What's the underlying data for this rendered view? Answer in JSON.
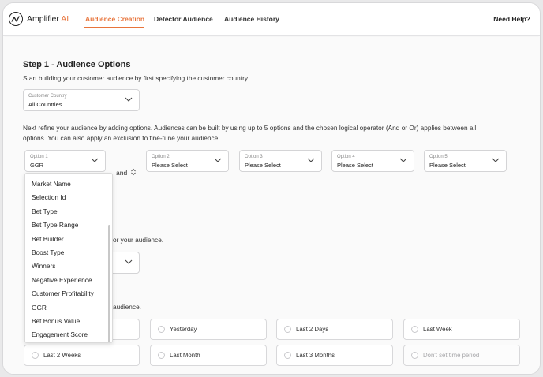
{
  "brand": {
    "name": "Amplifier",
    "suffix": "AI",
    "accent_color": "#e8743b"
  },
  "nav": {
    "tabs": [
      {
        "label": "Audience Creation",
        "active": true
      },
      {
        "label": "Defector Audience",
        "active": false
      },
      {
        "label": "Audience History",
        "active": false
      }
    ],
    "help_label": "Need Help?"
  },
  "step1": {
    "title": "Step 1 - Audience Options",
    "intro": "Start building your customer audience by first specifying the customer country.",
    "country": {
      "label": "Customer Country",
      "value": "All Countries"
    },
    "refine_line1": "Next refine your audience by adding options. Audiences can be built by using up to 5 options and the chosen logical operator (And or Or) applies between all",
    "refine_line2": "options. You can also apply an exclusion to fine-tune your audience.",
    "options": [
      {
        "label": "Option 1",
        "value": "GGR"
      },
      {
        "label": "Option 2",
        "value": "Please Select"
      },
      {
        "label": "Option 3",
        "value": "Please Select"
      },
      {
        "label": "Option 4",
        "value": "Please Select"
      },
      {
        "label": "Option 5",
        "value": "Please Select"
      }
    ],
    "operator": "and"
  },
  "dropdown": {
    "items": [
      "Market Name",
      "Selection Id",
      "Bet Type",
      "Bet Type Range",
      "Bet Builder",
      "Boost Type",
      "Winners",
      "Negative Experience",
      "Customer Profitability",
      "GGR",
      "Bet Bonus Value",
      "Engagement Score"
    ]
  },
  "partial_texts": {
    "exclusion_tail": "or your audience.",
    "period_tail": "audience."
  },
  "time_period": {
    "tiles": [
      {
        "label": "",
        "disabled": false
      },
      {
        "label": "Yesterday",
        "disabled": false
      },
      {
        "label": "Last 2 Days",
        "disabled": false
      },
      {
        "label": "Last Week",
        "disabled": false
      },
      {
        "label": "Last 2 Weeks",
        "disabled": false
      },
      {
        "label": "Last Month",
        "disabled": false
      },
      {
        "label": "Last 3 Months",
        "disabled": false
      },
      {
        "label": "Don't set time period",
        "disabled": true
      }
    ]
  }
}
